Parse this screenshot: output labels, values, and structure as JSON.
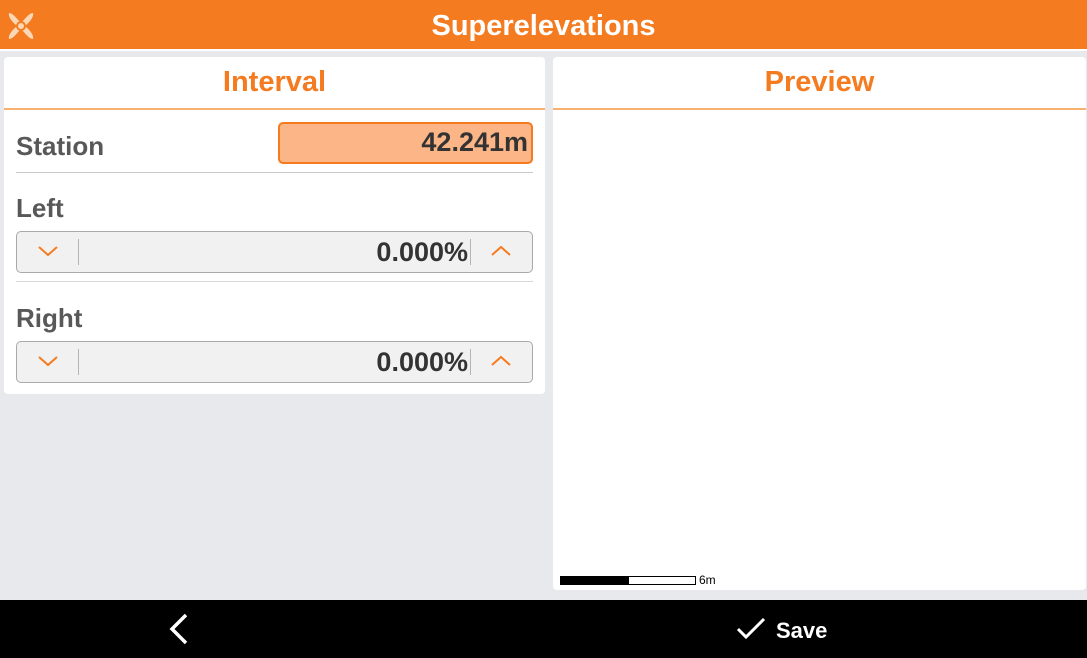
{
  "header": {
    "title": "Superelevations",
    "logo_icon": "app-x-logo-icon",
    "color": "#f47b20"
  },
  "interval": {
    "heading": "Interval",
    "station": {
      "label": "Station",
      "value": "42.241m"
    },
    "left": {
      "label": "Left",
      "value": "0.000%"
    },
    "right": {
      "label": "Right",
      "value": "0.000%"
    }
  },
  "preview": {
    "heading": "Preview",
    "scale_label": "6m"
  },
  "footer": {
    "back_icon": "chevron-left-icon",
    "save_icon": "checkmark-icon",
    "save_label": "Save"
  },
  "colors": {
    "accent": "#f47b20",
    "station_highlight": "#fbb586",
    "background": "#e8e9ec"
  }
}
